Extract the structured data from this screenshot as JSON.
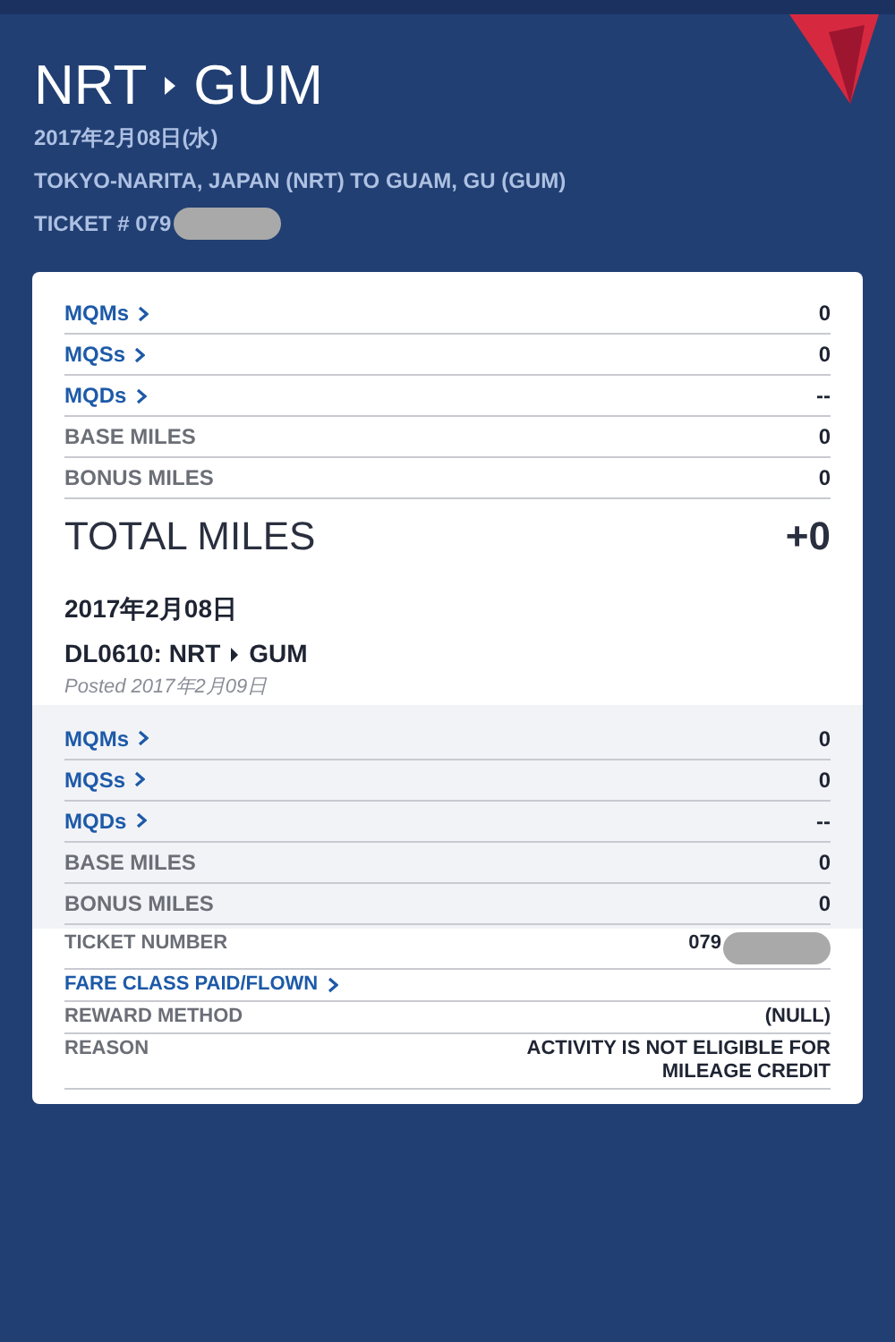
{
  "header": {
    "from": "NRT",
    "to": "GUM",
    "date": "2017年2月08日(水)",
    "description": "TOKYO-NARITA, JAPAN (NRT) TO GUAM, GU (GUM)",
    "ticket": "TICKET # 079",
    "ticket_redacted": true
  },
  "summary_rows": [
    {
      "kind": "link",
      "label": "MQMs",
      "value": "0"
    },
    {
      "kind": "link",
      "label": "MQSs",
      "value": "0"
    },
    {
      "kind": "link",
      "label": "MQDs",
      "value": "--"
    },
    {
      "kind": "label",
      "label": "BASE MILES",
      "value": "0"
    },
    {
      "kind": "label",
      "label": "BONUS MILES",
      "value": "0"
    }
  ],
  "total": {
    "label": "TOTAL MILES",
    "value": "+0"
  },
  "flight": {
    "date": "2017年2月08日",
    "code": "DL0610:",
    "from": "NRT",
    "to": "GUM",
    "posted": "Posted 2017年2月09日"
  },
  "detail_rows": [
    {
      "kind": "link",
      "label": "MQMs",
      "value": "0"
    },
    {
      "kind": "link",
      "label": "MQSs",
      "value": "0"
    },
    {
      "kind": "link",
      "label": "MQDs",
      "value": "--"
    },
    {
      "kind": "label",
      "label": "BASE MILES",
      "value": "0"
    },
    {
      "kind": "label",
      "label": "BONUS MILES",
      "value": "0"
    }
  ],
  "info_rows": [
    {
      "kind": "label",
      "label": "TICKET NUMBER",
      "value": "079",
      "redacted": true
    },
    {
      "kind": "link",
      "label": "FARE CLASS PAID/FLOWN"
    },
    {
      "kind": "label",
      "label": "REWARD METHOD",
      "value": "(NULL)"
    },
    {
      "kind": "label",
      "label": "REASON",
      "value": "ACTIVITY IS NOT ELIGIBLE FOR MILEAGE CREDIT"
    }
  ]
}
